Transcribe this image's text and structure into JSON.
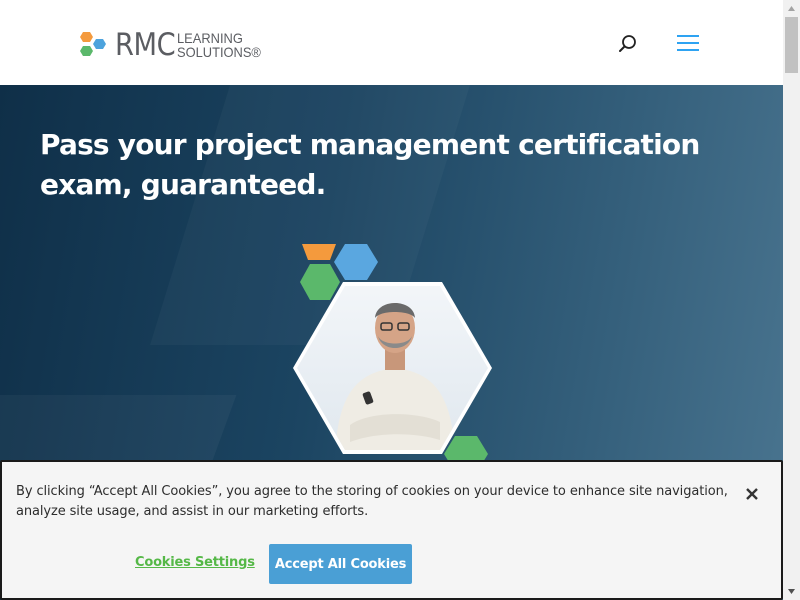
{
  "header": {
    "logo_main": "RMC",
    "logo_line1": "LEARNING",
    "logo_line2": "SOLUTIONS®",
    "logo_colors": [
      "#f49a3d",
      "#4da3dd",
      "#5bb86b"
    ]
  },
  "hero": {
    "title": "Pass your project management certification exam, guaranteed.",
    "accent_colors": [
      "#f49a3d",
      "#5aa7e0",
      "#5bb86b"
    ]
  },
  "cookie_banner": {
    "message": "By clicking “Accept All Cookies”, you agree to the storing of cookies on your device to enhance site navigation, analyze site usage, and assist in our marketing efforts.",
    "settings_label": "Cookies Settings",
    "accept_label": "Accept All Cookies"
  },
  "icons": {
    "search": "search-icon",
    "menu": "hamburger-menu-icon",
    "close": "close-icon"
  }
}
